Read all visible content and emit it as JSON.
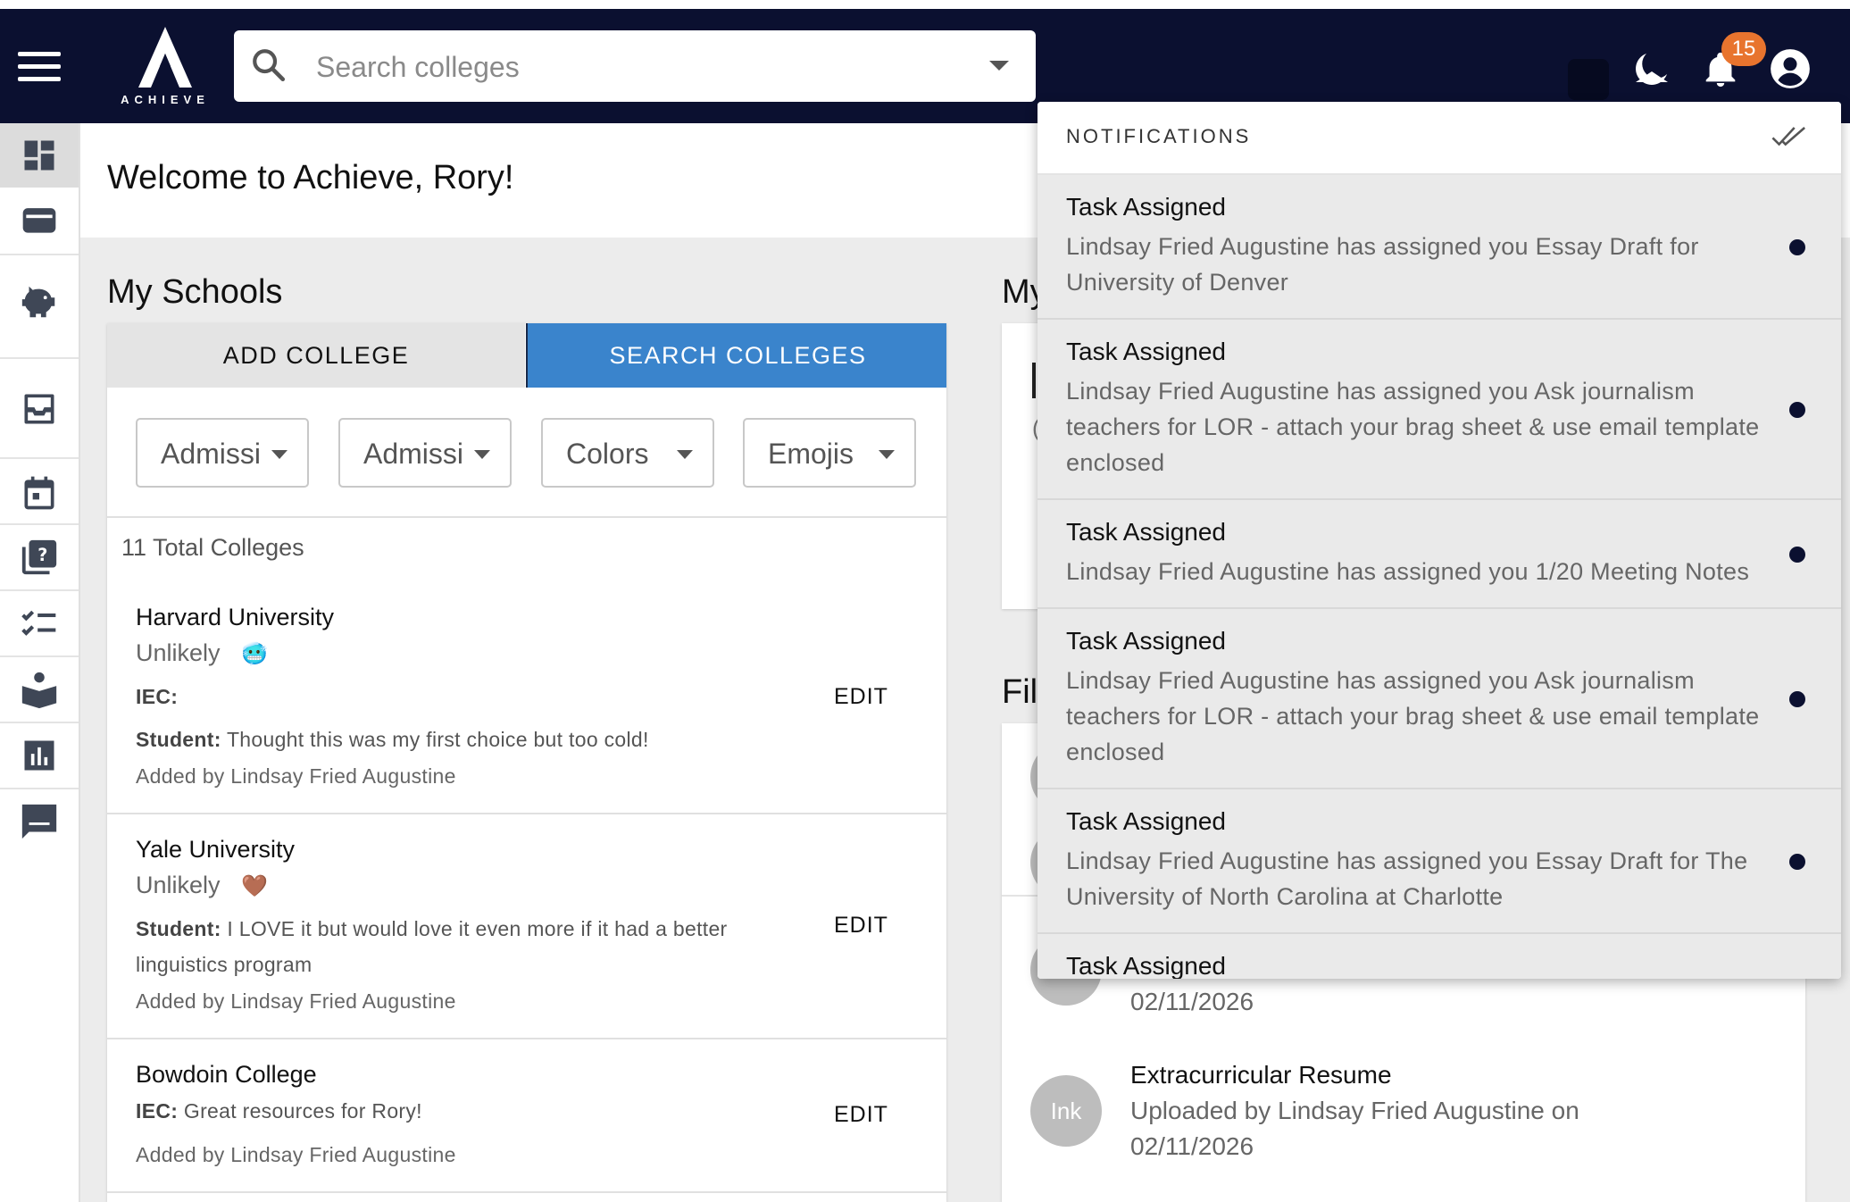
{
  "topbar": {
    "logo_text": "ACHIEVE",
    "search": {
      "placeholder": "Search colleges"
    },
    "notification_count": "15"
  },
  "sidebar": {
    "items": [
      "dashboard-icon",
      "wallet-icon",
      "piggy-bank-icon",
      "inbox-icon",
      "calendar-icon",
      "help-library-icon",
      "checklist-icon",
      "reading-icon",
      "bar-chart-icon",
      "signature-icon"
    ]
  },
  "welcome": {
    "title": "Welcome to Achieve, Rory!"
  },
  "my_schools": {
    "title": "My Schools",
    "tabs": {
      "add": "ADD COLLEGE",
      "search": "SEARCH COLLEGES"
    },
    "filters": [
      "Admissi",
      "Admissi",
      "Colors",
      "Emojis"
    ],
    "total": "11 Total Colleges",
    "colleges": [
      {
        "name": "Harvard University",
        "status": "Unlikely",
        "emoji": "🥶",
        "iec_label": "IEC:",
        "iec_text": "",
        "student_label": "Student:",
        "student_text": " Thought this was my first choice but too cold!",
        "added_by": "Added by Lindsay Fried Augustine",
        "edit": "EDIT"
      },
      {
        "name": "Yale University",
        "status": "Unlikely",
        "emoji": "🤎",
        "student_label": "Student:",
        "student_text": " I LOVE it but would love it even more if it had a better linguistics program",
        "added_by": "Added by Lindsay Fried Augustine",
        "edit": "EDIT"
      },
      {
        "name": "Bowdoin College",
        "iec_label": "IEC:",
        "iec_text": " Great resources for Rory!",
        "added_by": "Added by Lindsay Fried Augustine",
        "edit": "EDIT"
      }
    ]
  },
  "right_panel": {
    "title_partial_1": "My",
    "title_partial_2": "Fil",
    "files": [
      {
        "subtitle": "02/11/2026"
      },
      {
        "avatar": "Ink",
        "name": "Extracurricular Resume",
        "subtitle": "Uploaded by Lindsay Fried Augustine on",
        "date": "02/11/2026"
      }
    ]
  },
  "notifications": {
    "title": "NOTIFICATIONS",
    "items": [
      {
        "title": "Task Assigned",
        "body": "Lindsay Fried Augustine has assigned you Essay Draft for University of Denver"
      },
      {
        "title": "Task Assigned",
        "body": "Lindsay Fried Augustine has assigned you Ask journalism teachers for LOR - attach your brag sheet & use email template enclosed"
      },
      {
        "title": "Task Assigned",
        "body": "Lindsay Fried Augustine has assigned you 1/20 Meeting Notes"
      },
      {
        "title": "Task Assigned",
        "body": "Lindsay Fried Augustine has assigned you Ask journalism teachers for LOR - attach your brag sheet & use email template enclosed"
      },
      {
        "title": "Task Assigned",
        "body": "Lindsay Fried Augustine has assigned you Essay Draft for The University of North Carolina at Charlotte"
      },
      {
        "title": "Task Assigned",
        "body": ""
      }
    ]
  },
  "colors": {
    "navy": "#0b1030",
    "accent_blue": "#3a84cc",
    "badge_orange": "#e8742e"
  }
}
